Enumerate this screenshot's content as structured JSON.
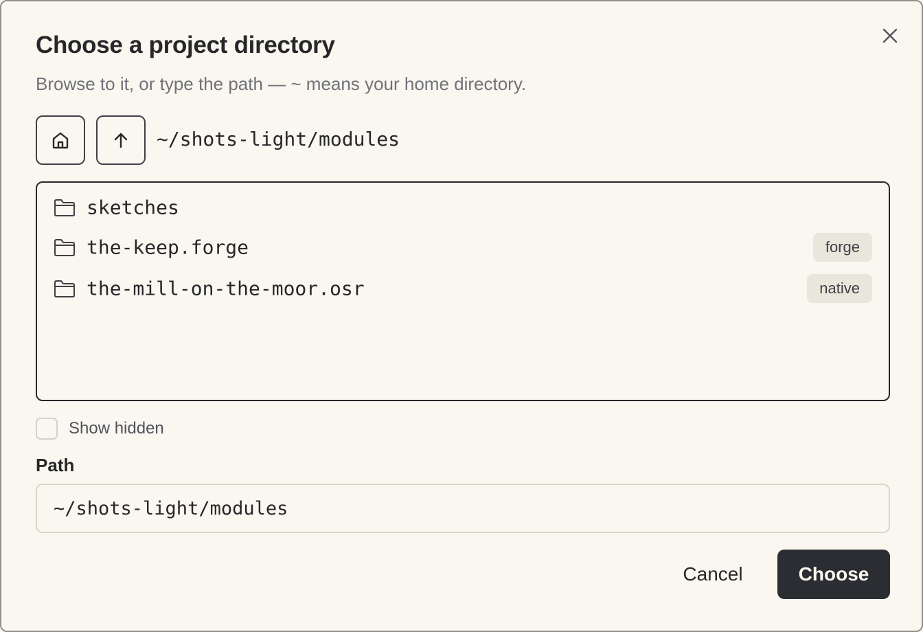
{
  "dialog": {
    "title": "Choose a project directory",
    "subtitle": "Browse to it, or type the path — ~ means your home directory.",
    "close_icon": "close-icon"
  },
  "navigation": {
    "home_icon": "home-icon",
    "up_icon": "arrow-up-icon",
    "current_path": "~/shots-light/modules"
  },
  "entries": [
    {
      "name": "sketches",
      "icon": "folder-icon",
      "badge": ""
    },
    {
      "name": "the-keep.forge",
      "icon": "folder-icon",
      "badge": "forge"
    },
    {
      "name": "the-mill-on-the-moor.osr",
      "icon": "folder-icon",
      "badge": "native"
    }
  ],
  "options": {
    "show_hidden_label": "Show hidden",
    "show_hidden_checked": false
  },
  "path_field": {
    "label": "Path",
    "value": "~/shots-light/modules"
  },
  "actions": {
    "cancel_label": "Cancel",
    "choose_label": "Choose"
  },
  "colors": {
    "background": "#f9f7ef",
    "text": "#27272a",
    "muted_text": "#71717a",
    "primary_button": "#2b2d33",
    "badge_background": "#e9e7dc"
  }
}
